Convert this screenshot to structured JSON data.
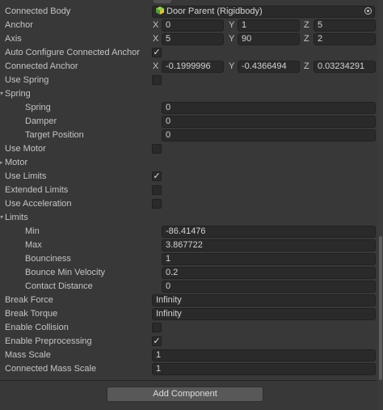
{
  "rows": {
    "connected_body": {
      "label": "Connected Body",
      "value": "Door Parent (Rigidbody)",
      "icon": "rigidbody-icon"
    },
    "anchor": {
      "label": "Anchor",
      "x": "0",
      "y": "1",
      "z": "5"
    },
    "axis": {
      "label": "Axis",
      "x": "5",
      "y": "90",
      "z": "2"
    },
    "auto_configure": {
      "label": "Auto Configure Connected Anchor",
      "checked": true
    },
    "connected_anchor": {
      "label": "Connected Anchor",
      "x": "-0.1999996",
      "y": "-0.4366494",
      "z": "0.03234291"
    },
    "use_spring": {
      "label": "Use Spring",
      "checked": false
    },
    "spring_section": {
      "label": "Spring"
    },
    "spring": {
      "label": "Spring",
      "value": "0"
    },
    "damper": {
      "label": "Damper",
      "value": "0"
    },
    "target_position": {
      "label": "Target Position",
      "value": "0"
    },
    "use_motor": {
      "label": "Use Motor",
      "checked": false
    },
    "motor_section": {
      "label": "Motor"
    },
    "use_limits": {
      "label": "Use Limits",
      "checked": true
    },
    "extended_limits": {
      "label": "Extended Limits",
      "checked": false
    },
    "use_acceleration": {
      "label": "Use Acceleration",
      "checked": false
    },
    "limits_section": {
      "label": "Limits"
    },
    "min": {
      "label": "Min",
      "value": "-86.41476"
    },
    "max": {
      "label": "Max",
      "value": "3.867722"
    },
    "bounciness": {
      "label": "Bounciness",
      "value": "1"
    },
    "bounce_min_velocity": {
      "label": "Bounce Min Velocity",
      "value": "0.2"
    },
    "contact_distance": {
      "label": "Contact Distance",
      "value": "0"
    },
    "break_force": {
      "label": "Break Force",
      "value": "Infinity"
    },
    "break_torque": {
      "label": "Break Torque",
      "value": "Infinity"
    },
    "enable_collision": {
      "label": "Enable Collision",
      "checked": false
    },
    "enable_preprocessing": {
      "label": "Enable Preprocessing",
      "checked": true
    },
    "mass_scale": {
      "label": "Mass Scale",
      "value": "1"
    },
    "connected_mass_scale": {
      "label": "Connected Mass Scale",
      "value": "1"
    }
  },
  "axis_labels": {
    "x": "X",
    "y": "Y",
    "z": "Z"
  },
  "glyphs": {
    "check": "✓",
    "fold": "▾"
  },
  "add_component_label": "Add Component",
  "colors": {
    "background": "#383838",
    "field": "#2a2a2a",
    "button": "#585858",
    "text": "#c4c4c4"
  }
}
